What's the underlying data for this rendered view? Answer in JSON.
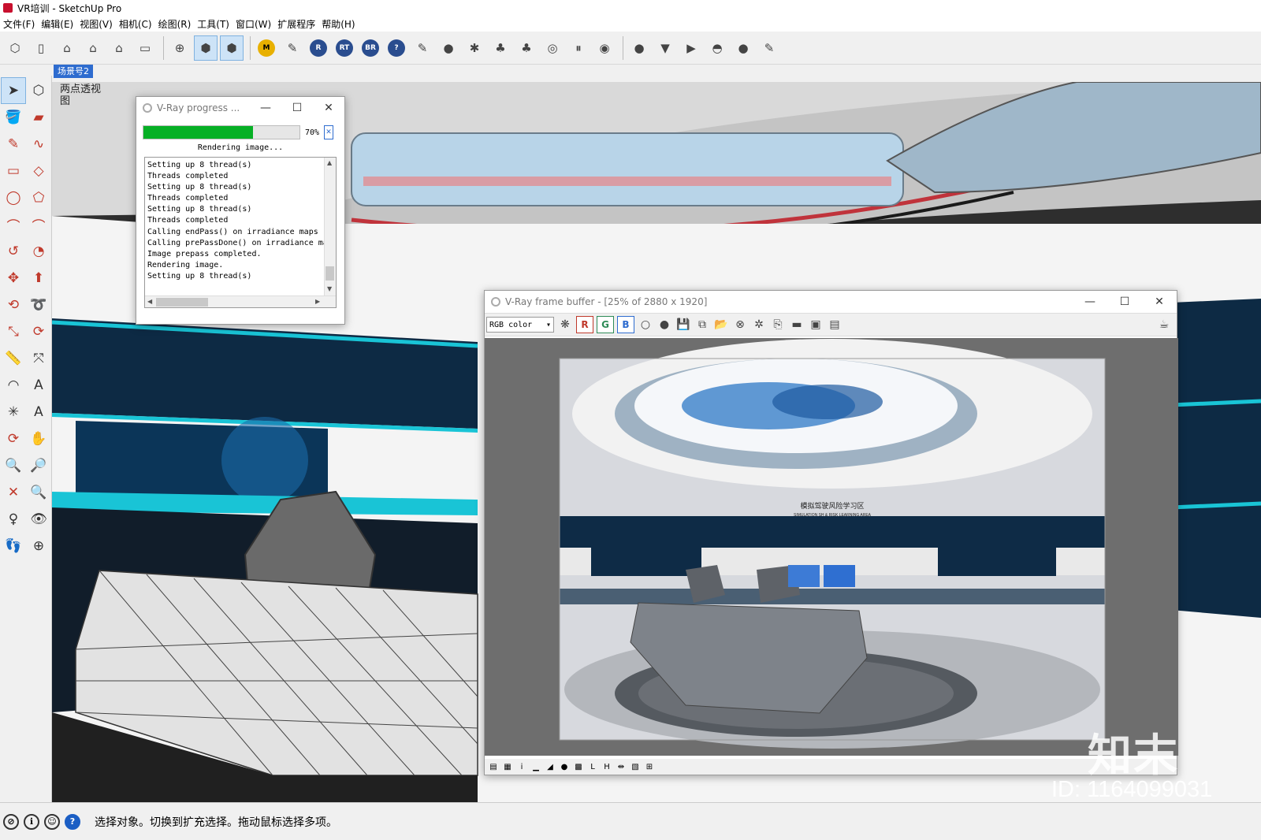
{
  "window": {
    "title": "VR培训 - SketchUp Pro"
  },
  "menu": [
    "文件(F)",
    "编辑(E)",
    "视图(V)",
    "相机(C)",
    "绘图(R)",
    "工具(T)",
    "窗口(W)",
    "扩展程序",
    "帮助(H)"
  ],
  "toolbar": {
    "vray_buttons": [
      "M",
      "R",
      "RT",
      "BR",
      "?"
    ]
  },
  "scene": {
    "tab_label": "场景号2",
    "view_label": "两点透视图"
  },
  "progress_window": {
    "title": "V-Ray progress ...",
    "percent": 70,
    "percent_label": "70%",
    "status": "Rendering image...",
    "log": [
      "Setting up 8 thread(s)",
      "Threads completed",
      "Setting up 8 thread(s)",
      "Threads completed",
      "Setting up 8 thread(s)",
      "Threads completed",
      "Calling endPass() on irradiance maps",
      "Calling prePassDone() on irradiance map",
      "Image prepass completed.",
      "Rendering image.",
      "Setting up 8 thread(s)"
    ]
  },
  "frame_buffer": {
    "title": "V-Ray frame buffer - [25% of 2880 x 1920]",
    "channel": "RGB color",
    "channels": [
      "R",
      "G",
      "B"
    ],
    "render_caption": "模拟驾驶风险学习区",
    "render_subcaption": "SIMULATION SH & RISK LEARNING AREA"
  },
  "status": {
    "text": "选择对象。切换到扩充选择。拖动鼠标选择多项。"
  },
  "watermark": {
    "logo": "知末",
    "id": "ID: 1164099031"
  },
  "colors": {
    "accent": "#2e6ccf",
    "progress": "#06b025",
    "screen_cyan": "#19c4d6"
  }
}
